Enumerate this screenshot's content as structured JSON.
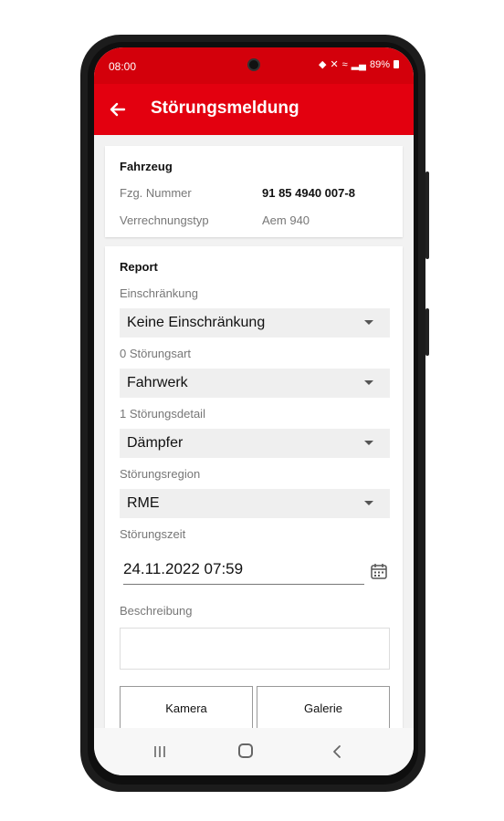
{
  "status_bar": {
    "time": "08:00",
    "battery": "89%"
  },
  "app_bar": {
    "title": "Störungsmeldung"
  },
  "vehicle": {
    "heading": "Fahrzeug",
    "number_label": "Fzg. Nummer",
    "number_value": "91 85 4940 007-8",
    "billing_label": "Verrechnungstyp",
    "billing_value": "Aem 940"
  },
  "report": {
    "heading": "Report",
    "restriction_label": "Einschränkung",
    "restriction_value": "Keine Einschränkung",
    "fault_type_label": "0 Störungsart",
    "fault_type_value": "Fahrwerk",
    "fault_detail_label": "1 Störungsdetail",
    "fault_detail_value": "Dämpfer",
    "fault_region_label": "Störungsregion",
    "fault_region_value": "RME",
    "fault_time_label": "Störungszeit",
    "fault_time_value": "24.11.2022 07:59",
    "description_label": "Beschreibung",
    "description_value": "",
    "camera_button": "Kamera",
    "gallery_button": "Galerie"
  },
  "colors": {
    "accent": "#e3000f",
    "status_bar": "#d3000b"
  }
}
